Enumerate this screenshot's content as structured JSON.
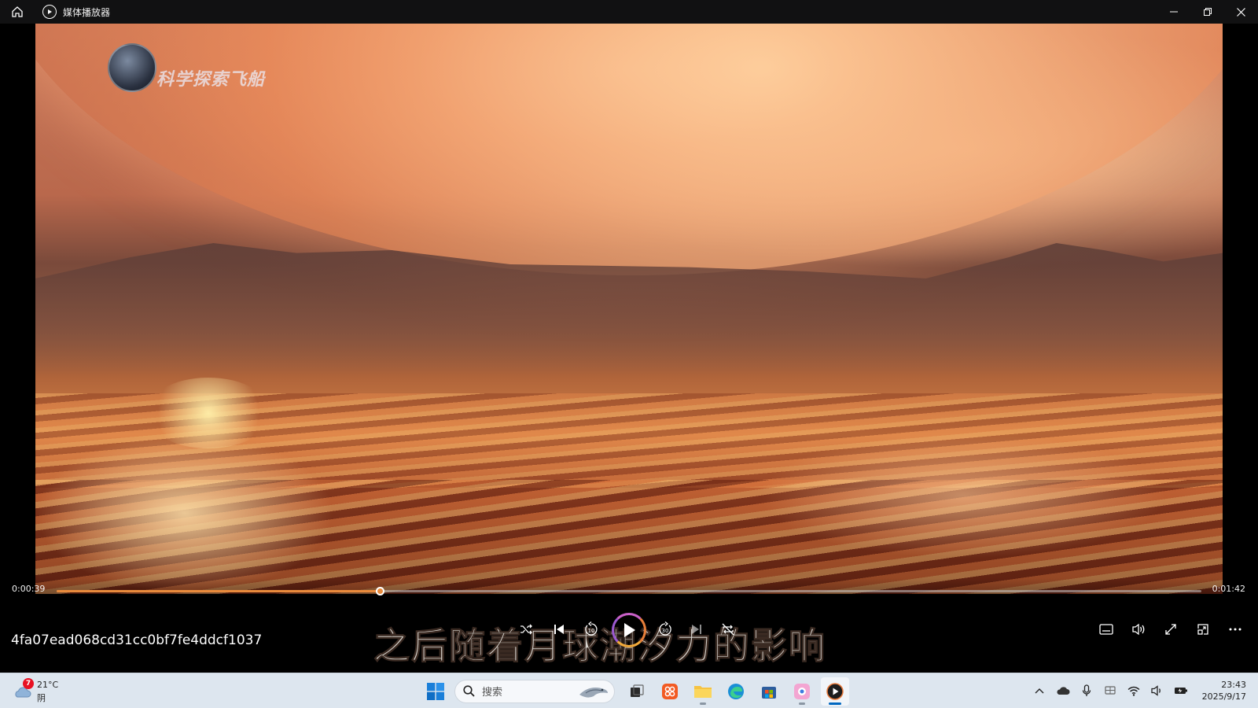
{
  "window": {
    "title": "媒体播放器"
  },
  "video": {
    "watermark_text": "科学探索飞船",
    "subtitle": "之后随着月球潮汐力的影响"
  },
  "player": {
    "current_time": "0:00:39",
    "total_time": "0:01:42",
    "progress_fraction": 0.282,
    "file_name": "4fa07ead068cd31cc0bf7fe4ddcf1037",
    "accent_color": "#e88a3c",
    "buttons": {
      "shuffle": "shuffle-icon",
      "previous": "skip-previous-icon",
      "rewind": "rewind-10-icon",
      "play": "play-icon",
      "forward": "forward-30-icon",
      "next": "skip-next-icon",
      "repeat": "repeat-off-icon",
      "subtitles": "subtitles-icon",
      "volume": "volume-icon",
      "fullscreen": "fullscreen-icon",
      "miniplayer": "miniplayer-icon",
      "more": "more-icon"
    },
    "rewind_label": "10",
    "forward_label": "30"
  },
  "taskbar": {
    "weather_badge": "7",
    "weather_temp": "21°C",
    "weather_condition": "阴",
    "search_placeholder": "搜索",
    "time": "23:43",
    "date": "2025/9/17"
  }
}
